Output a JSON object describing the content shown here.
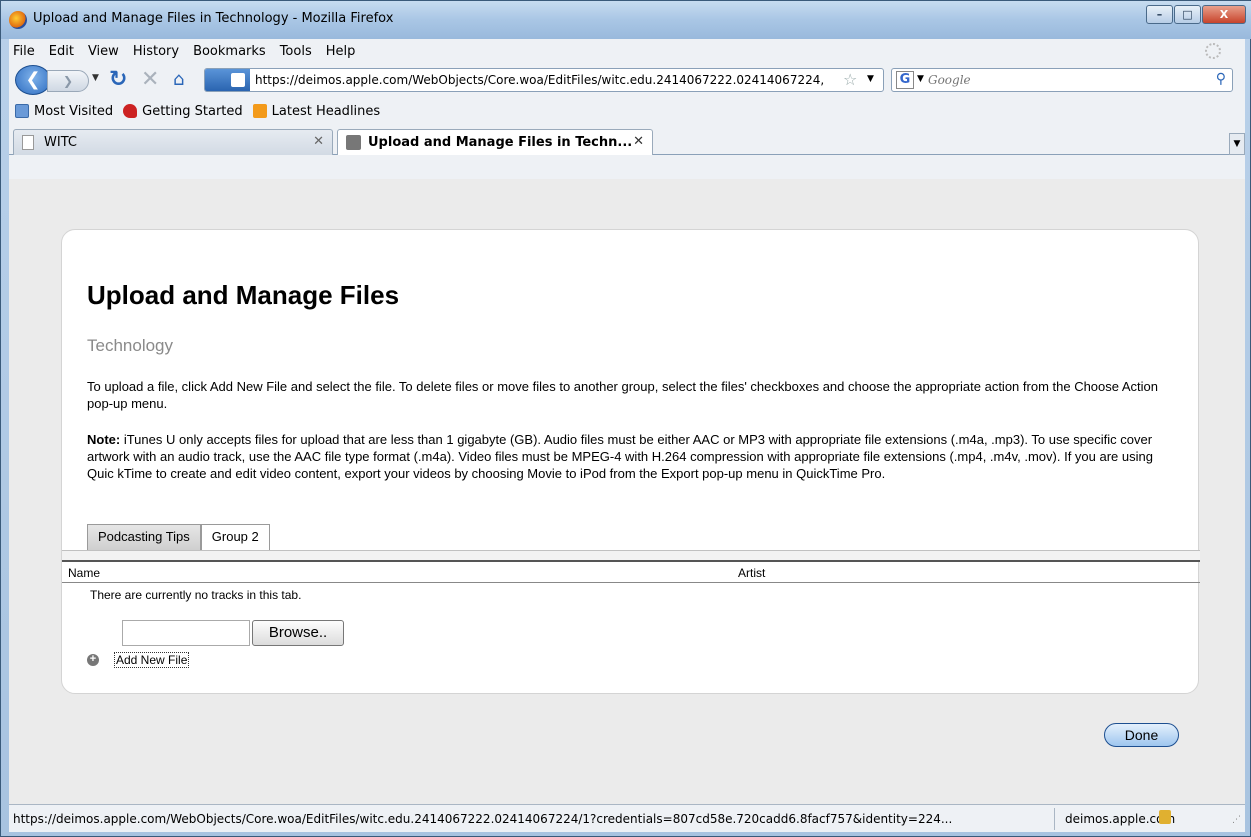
{
  "window": {
    "title": "Upload and Manage Files in Technology - Mozilla Firefox",
    "minimize_glyph": "–",
    "maximize_glyph": "□",
    "close_glyph": "X"
  },
  "menu": [
    "File",
    "Edit",
    "View",
    "History",
    "Bookmarks",
    "Tools",
    "Help"
  ],
  "navigation": {
    "url": "https://deimos.apple.com/WebObjects/Core.woa/EditFiles/witc.edu.2414067222.02414067224,",
    "search_placeholder": "Google",
    "search_engine_glyph": "G"
  },
  "bookmarks": [
    "Most Visited",
    "Getting Started",
    "Latest Headlines"
  ],
  "tabs": [
    {
      "label": "WITC",
      "active": false
    },
    {
      "label": "Upload and Manage Files in Techn...",
      "active": true
    }
  ],
  "page": {
    "title": "Upload and Manage Files",
    "subtitle": "Technology",
    "instructions": "To upload a file, click Add New File and select the file. To delete files or move files to another group, select the files' checkboxes and choose the appropriate action from the Choose Action pop-up menu.",
    "note_label": "Note:",
    "note_text": " iTunes U only accepts files for upload that are less than 1 gigabyte (GB). Audio files must be either AAC or MP3 with appropriate file extensions (.m4a, .mp3). To use specific cover artwork with an audio track, use the AAC file type format (.m4a). Video files must be MPEG-4 with H.264 compression with appropriate file extensions (.mp4, .m4v, .mov). If you are using Quic kTime to create and edit video content, export your videos by choosing Movie to iPod from the Export pop-up menu in QuickTime Pro.",
    "group_tabs": [
      "Podcasting Tips",
      "Group 2"
    ],
    "columns": {
      "name": "Name",
      "artist": "Artist"
    },
    "empty_message": "There are currently no tracks in this tab.",
    "browse_label": "Browse..",
    "add_new_file_label": "Add New File",
    "done_label": "Done"
  },
  "status": {
    "url": "https://deimos.apple.com/WebObjects/Core.woa/EditFiles/witc.edu.2414067222.02414067224/1?credentials=807cd58e.720cadd6.8facf757&identity=224...",
    "host": "deimos.apple.com"
  }
}
